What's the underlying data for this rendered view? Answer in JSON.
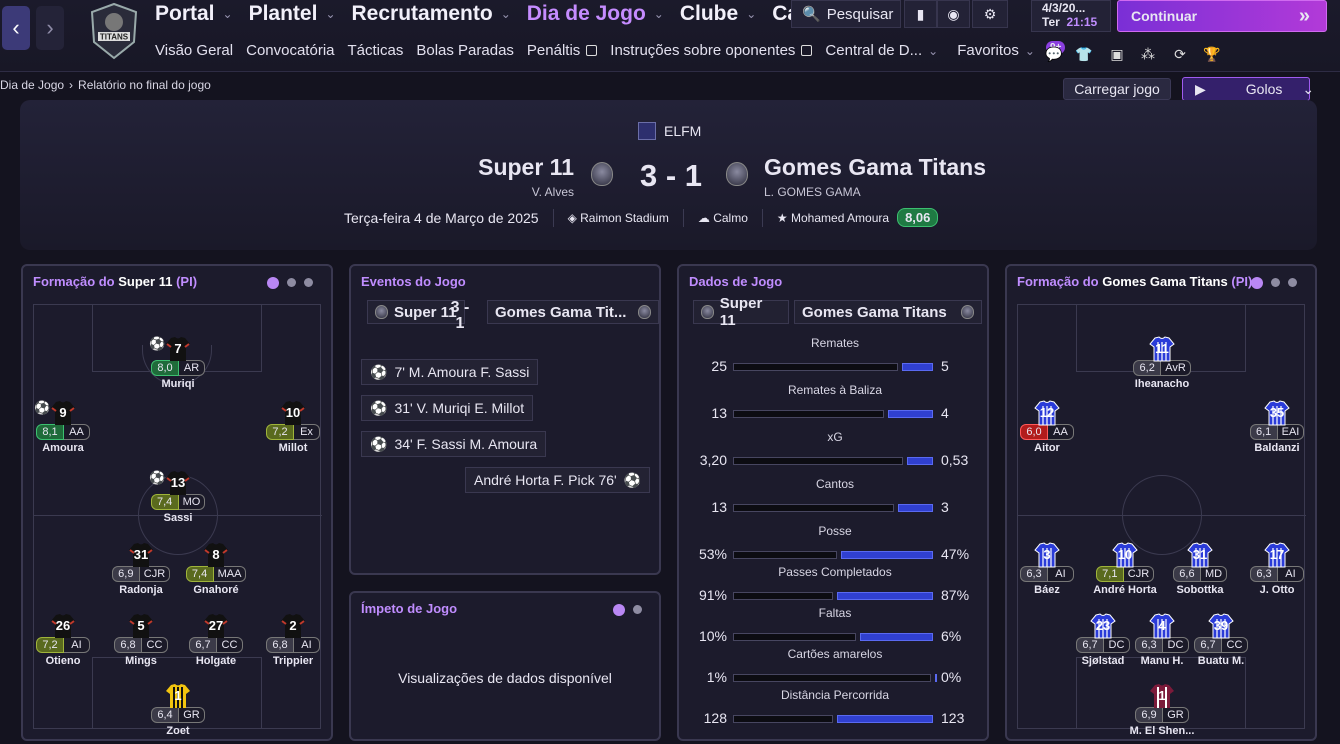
{
  "nav": {
    "menu": [
      {
        "label": "Portal"
      },
      {
        "label": "Plantel"
      },
      {
        "label": "Recrutamento"
      },
      {
        "label": "Dia de Jogo",
        "active": true
      },
      {
        "label": "Clube"
      },
      {
        "label": "Carreira"
      }
    ],
    "submenu": [
      "Visão Geral",
      "Convocatória",
      "Tácticas",
      "Bolas Paradas",
      "Penáltis",
      "Instruções sobre oponentes",
      "Central de D...",
      "Favoritos"
    ],
    "search": "Pesquisar",
    "date": "4/3/20...",
    "weekday": "Ter",
    "time": "21:15",
    "continue": "Continuar",
    "notifications": "9+"
  },
  "breadcrumb": [
    "Dia de Jogo",
    "Relatório no final do jogo"
  ],
  "buttons": {
    "load": "Carregar jogo",
    "goals": "Golos"
  },
  "match": {
    "competition": "ELFM",
    "home": "Super 11",
    "home_manager": "V. Alves",
    "away": "Gomes Gama Titans",
    "away_manager": "L. GOMES GAMA",
    "score": "3 - 1",
    "date": "Terça-feira 4 de Março de 2025",
    "stadium": "Raimon Stadium",
    "weather": "Calmo",
    "motm": "Mohamed Amoura",
    "motm_rating": "8,06"
  },
  "home_formation": {
    "title_prefix": "Formação do",
    "team": "Super 11",
    "tag": "(PI)",
    "players": [
      {
        "num": "7",
        "rating": "8,0",
        "pos": "AR",
        "name": "Muriqi",
        "tone": "green",
        "goal": true
      },
      {
        "num": "9",
        "rating": "8,1",
        "pos": "AA",
        "name": "Amoura",
        "tone": "green",
        "goal": true
      },
      {
        "num": "10",
        "rating": "7,2",
        "pos": "Ex",
        "name": "Millot",
        "tone": "olive"
      },
      {
        "num": "13",
        "rating": "7,4",
        "pos": "MO",
        "name": "Sassi",
        "tone": "olive",
        "goal": true
      },
      {
        "num": "31",
        "rating": "6,9",
        "pos": "CJR",
        "name": "Radonja",
        "tone": ""
      },
      {
        "num": "8",
        "rating": "7,4",
        "pos": "MAA",
        "name": "Gnahoré",
        "tone": "olive"
      },
      {
        "num": "26",
        "rating": "7,2",
        "pos": "AI",
        "name": "Otieno",
        "tone": "olive"
      },
      {
        "num": "5",
        "rating": "6,8",
        "pos": "CC",
        "name": "Mings",
        "tone": ""
      },
      {
        "num": "27",
        "rating": "6,7",
        "pos": "CC",
        "name": "Holgate",
        "tone": ""
      },
      {
        "num": "2",
        "rating": "6,8",
        "pos": "AI",
        "name": "Trippier",
        "tone": ""
      },
      {
        "num": "1",
        "rating": "6,4",
        "pos": "GR",
        "name": "Zoet",
        "tone": ""
      }
    ]
  },
  "away_formation": {
    "title_prefix": "Formação do",
    "team": "Gomes Gama Titans",
    "tag": "(PI)",
    "players": [
      {
        "num": "11",
        "rating": "6,2",
        "pos": "AvR",
        "name": "Iheanacho",
        "tone": ""
      },
      {
        "num": "12",
        "rating": "6,0",
        "pos": "AA",
        "name": "Aitor",
        "tone": "red"
      },
      {
        "num": "35",
        "rating": "6,1",
        "pos": "EAI",
        "name": "Baldanzi",
        "tone": ""
      },
      {
        "num": "3",
        "rating": "6,3",
        "pos": "AI",
        "name": "Báez",
        "tone": ""
      },
      {
        "num": "10",
        "rating": "7,1",
        "pos": "CJR",
        "name": "André Horta",
        "tone": "olive"
      },
      {
        "num": "31",
        "rating": "6,6",
        "pos": "MD",
        "name": "Sobottka",
        "tone": ""
      },
      {
        "num": "17",
        "rating": "6,3",
        "pos": "AI",
        "name": "J. Otto",
        "tone": ""
      },
      {
        "num": "23",
        "rating": "6,7",
        "pos": "DC",
        "name": "Sjølstad",
        "tone": ""
      },
      {
        "num": "4",
        "rating": "6,3",
        "pos": "DC",
        "name": "Manu H.",
        "tone": ""
      },
      {
        "num": "39",
        "rating": "6,7",
        "pos": "CC",
        "name": "Buatu M.",
        "tone": ""
      },
      {
        "num": "1",
        "rating": "6,9",
        "pos": "GR",
        "name": "M. El Shen...",
        "tone": ""
      }
    ]
  },
  "events": {
    "title": "Eventos do Jogo",
    "home": "Super 11",
    "away": "Gomes Gama Tit...",
    "score": "3 - 1",
    "list": [
      "7' M. Amoura F. Sassi",
      "31' V. Muriqi E. Millot",
      "34' F. Sassi M. Amoura",
      "André Horta F. Pick 76'"
    ]
  },
  "impetus": {
    "title": "Ímpeto de Jogo",
    "text": "Visualizações de dados disponível"
  },
  "stats": {
    "title": "Dados de Jogo",
    "home": "Super 11",
    "away": "Gomes Gama Titans",
    "rows": [
      {
        "label": "Remates",
        "h": "25",
        "a": "5",
        "hv": 25,
        "av": 5
      },
      {
        "label": "Remates à Baliza",
        "h": "13",
        "a": "4",
        "hv": 13,
        "av": 4
      },
      {
        "label": "xG",
        "h": "3,20",
        "a": "0,53",
        "hv": 3.2,
        "av": 0.53
      },
      {
        "label": "Cantos",
        "h": "13",
        "a": "3",
        "hv": 13,
        "av": 3
      },
      {
        "label": "Posse",
        "h": "53%",
        "a": "47%",
        "hv": 53,
        "av": 47
      },
      {
        "label": "Passes Completados",
        "h": "91%",
        "a": "87%",
        "hv": 91,
        "av": 87
      },
      {
        "label": "Faltas",
        "h": "10%",
        "a": "6%",
        "hv": 10,
        "av": 6
      },
      {
        "label": "Cartões amarelos",
        "h": "1%",
        "a": "0%",
        "hv": 1,
        "av": 0
      },
      {
        "label": "Distância Percorrida",
        "h": "128",
        "a": "123",
        "hv": 128,
        "av": 123
      }
    ]
  }
}
